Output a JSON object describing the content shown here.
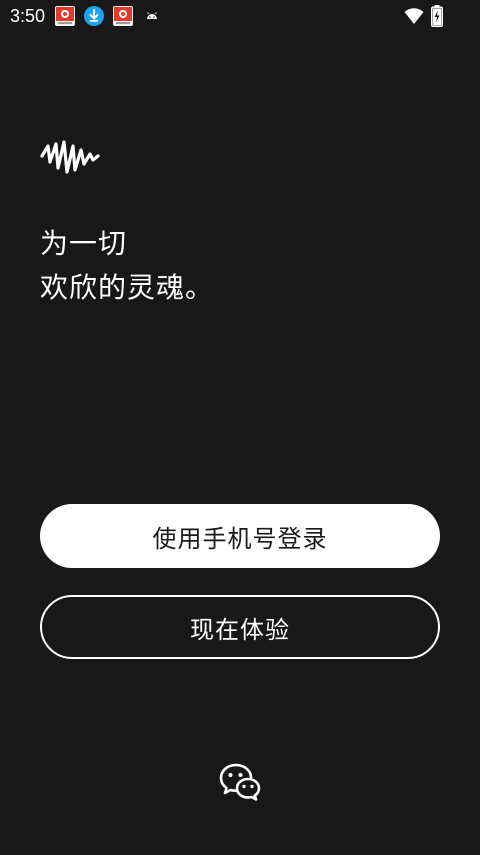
{
  "status_bar": {
    "time": "3:50",
    "icons": [
      "app-notification-icon",
      "download-icon",
      "app-notification-icon",
      "android-icon",
      "wifi-icon",
      "battery-charging-icon"
    ]
  },
  "brand": {
    "logo_icon": "soundwave-logo-icon"
  },
  "tagline": {
    "line1": "为一切",
    "line2": "欢欣的灵魂。"
  },
  "buttons": {
    "phone_login": "使用手机号登录",
    "try_now": "现在体验"
  },
  "wechat": {
    "icon": "wechat-icon"
  },
  "colors": {
    "background": "#181818",
    "primary_button_bg": "#ffffff",
    "primary_button_text": "#1a1a1a",
    "text": "#ffffff"
  }
}
